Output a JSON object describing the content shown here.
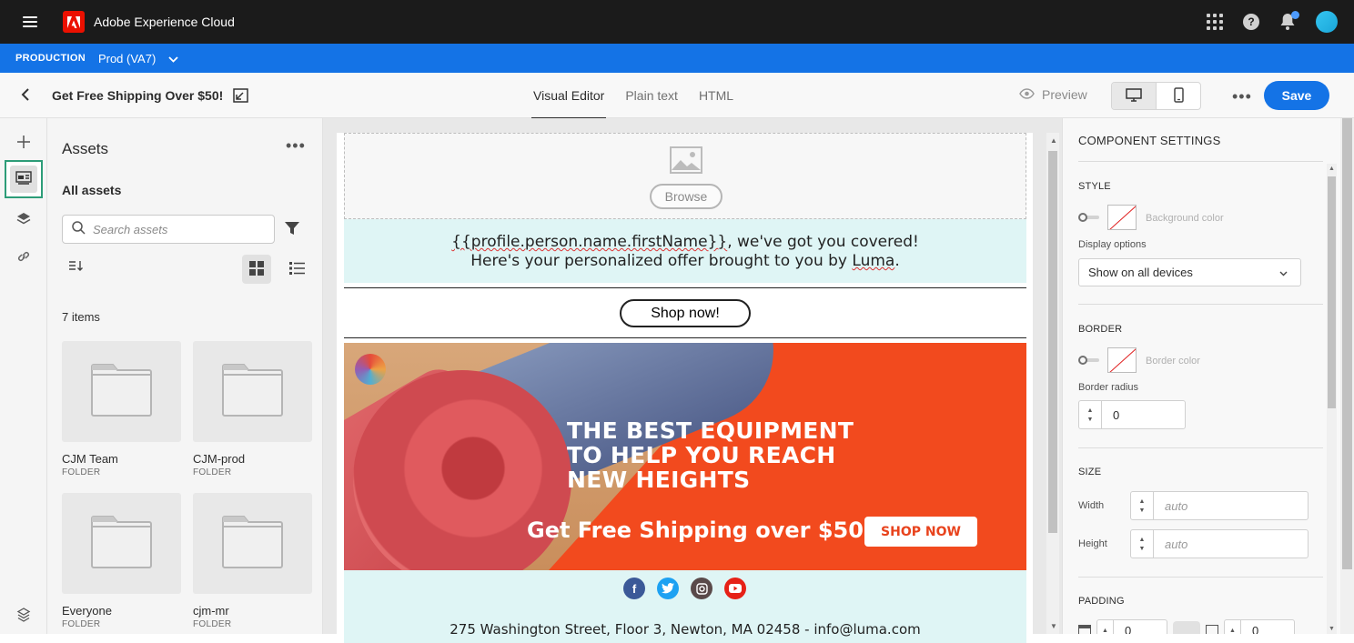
{
  "topbar": {
    "app_title": "Adobe Experience Cloud"
  },
  "envbar": {
    "label": "PRODUCTION",
    "sandbox": "Prod (VA7)"
  },
  "header": {
    "title": "Get Free Shipping Over $50!",
    "tabs": [
      {
        "label": "Visual Editor",
        "active": true
      },
      {
        "label": "Plain text"
      },
      {
        "label": "HTML"
      }
    ],
    "preview_label": "Preview",
    "save_label": "Save"
  },
  "assets": {
    "heading": "Assets",
    "subheading": "All assets",
    "search_placeholder": "Search assets",
    "count": "7 items",
    "items": [
      {
        "name": "CJM Team",
        "type": "FOLDER"
      },
      {
        "name": "CJM-prod",
        "type": "FOLDER"
      },
      {
        "name": "Everyone",
        "type": "FOLDER"
      },
      {
        "name": "cjm-mr",
        "type": "FOLDER"
      }
    ]
  },
  "email": {
    "browse_label": "Browse",
    "greeting_var": "{{profile.person.name.firstName}}",
    "greeting_rest": ", we've got you covered!",
    "offer_prefix": "Here's your personalized offer brought to you by ",
    "brand": "Luma",
    "offer_suffix": ".",
    "shop_button": "Shop now!",
    "banner": {
      "headline_1": "THE BEST EQUIPMENT",
      "headline_2": "TO HELP YOU REACH",
      "headline_3": "NEW HEIGHTS",
      "free_shipping": "Get Free Shipping over $50",
      "cta": "SHOP NOW"
    },
    "social": [
      "facebook",
      "twitter",
      "instagram",
      "youtube"
    ],
    "address": "275 Washington Street, Floor 3, Newton, MA 02458 - info@luma.com"
  },
  "settings": {
    "heading": "COMPONENT SETTINGS",
    "style_section": "STYLE",
    "background_color_label": "Background color",
    "display_options_label": "Display options",
    "display_options_value": "Show on all devices",
    "border_section": "BORDER",
    "border_color_label": "Border color",
    "border_radius_label": "Border radius",
    "border_radius_value": "0",
    "size_section": "SIZE",
    "width_label": "Width",
    "width_placeholder": "auto",
    "height_label": "Height",
    "height_placeholder": "auto",
    "padding_section": "PADDING",
    "padding_values": [
      "0",
      "0"
    ]
  },
  "colors": {
    "accent": "#1473e6",
    "topbar": "#1b1b1b",
    "selected_rail": "#2d9d78",
    "banner_orange": "#f24a1e",
    "email_tint": "#dff5f5"
  }
}
